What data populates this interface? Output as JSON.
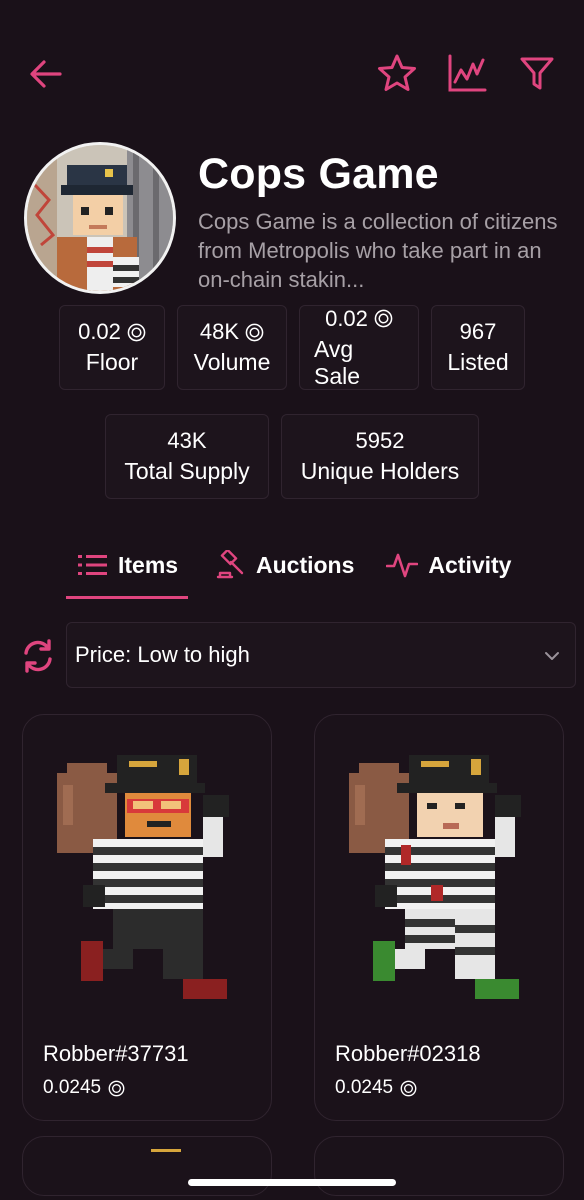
{
  "colors": {
    "accent": "#e0457f",
    "background": "#1a1119",
    "card_border": "#30242f",
    "muted_text": "#a7a0a6"
  },
  "topbar": {
    "back_icon": "arrow-left-icon",
    "actions": [
      {
        "icon": "star-icon"
      },
      {
        "icon": "chart-icon"
      },
      {
        "icon": "filter-icon"
      }
    ]
  },
  "collection": {
    "title": "Cops Game",
    "description": "Cops Game is a collection of citizens from Metropolis who take part in an on-chain stakin..."
  },
  "stats": [
    {
      "value": "0.02",
      "label": "Floor",
      "coin": true
    },
    {
      "value": "48K",
      "label": "Volume",
      "coin": true
    },
    {
      "value": "0.02",
      "label": "Avg Sale",
      "coin": true
    },
    {
      "value": "967",
      "label": "Listed",
      "coin": false
    },
    {
      "value": "43K",
      "label": "Total Supply",
      "coin": false
    },
    {
      "value": "5952",
      "label": "Unique Holders",
      "coin": false
    }
  ],
  "tabs": [
    {
      "label": "Items",
      "icon": "list-icon",
      "active": true
    },
    {
      "label": "Auctions",
      "icon": "gavel-icon",
      "active": false
    },
    {
      "label": "Activity",
      "icon": "activity-icon",
      "active": false
    }
  ],
  "sort": {
    "icon": "refresh-icon",
    "selected": "Price: Low to high"
  },
  "items": [
    {
      "name": "Robber#37731",
      "price": "0.0245"
    },
    {
      "name": "Robber#02318",
      "price": "0.0245"
    }
  ]
}
